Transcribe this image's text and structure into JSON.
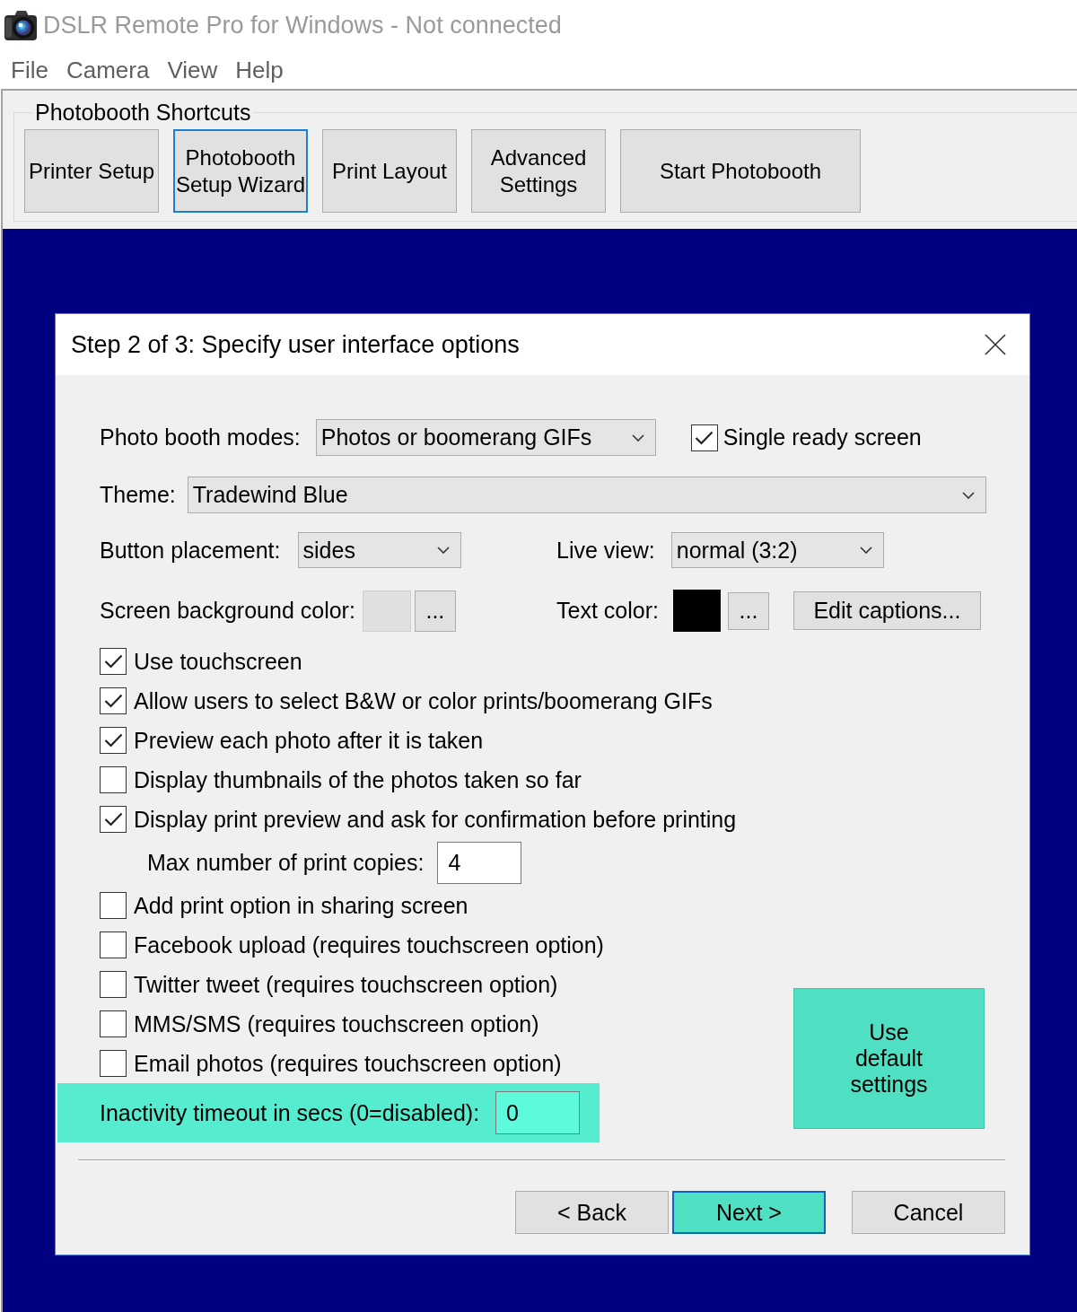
{
  "window": {
    "title": "DSLR Remote Pro for Windows - Not connected"
  },
  "menu": [
    "File",
    "Camera",
    "View",
    "Help"
  ],
  "shortcuts": {
    "title": "Photobooth Shortcuts",
    "buttons": [
      {
        "label": "Printer Setup",
        "focused": false
      },
      {
        "label": "Photobooth Setup Wizard",
        "focused": true
      },
      {
        "label": "Print Layout",
        "focused": false
      },
      {
        "label": "Advanced Settings",
        "focused": false
      },
      {
        "label": "Start Photobooth",
        "focused": false
      }
    ]
  },
  "dialog": {
    "title": "Step 2 of 3: Specify user interface options",
    "modes": {
      "label": "Photo booth modes:",
      "value": "Photos or boomerang GIFs"
    },
    "single_ready_screen": {
      "label": "Single ready screen",
      "checked": true
    },
    "theme": {
      "label": "Theme:",
      "value": "Tradewind Blue"
    },
    "button_placement": {
      "label": "Button placement:",
      "value": "sides"
    },
    "live_view": {
      "label": "Live view:",
      "value": "normal (3:2)"
    },
    "screen_background_color": {
      "label": "Screen background color:",
      "color": "#e0e0e0",
      "button": "..."
    },
    "text_color": {
      "label": "Text color:",
      "color": "#000000",
      "button": "..."
    },
    "edit_captions": {
      "label": "Edit captions..."
    },
    "options": [
      {
        "kind": "checkbox",
        "label": "Use touchscreen",
        "checked": true
      },
      {
        "kind": "checkbox",
        "label": "Allow users to select B&W or color prints/boomerang GIFs",
        "checked": true
      },
      {
        "kind": "checkbox",
        "label": "Preview each photo after it is taken",
        "checked": true
      },
      {
        "kind": "checkbox",
        "label": "Display thumbnails of the photos taken so far",
        "checked": false
      },
      {
        "kind": "checkbox",
        "label": "Display print preview and ask for confirmation before printing",
        "checked": true,
        "children": [
          {
            "kind": "field",
            "label": "Max number of print copies:",
            "value": "4"
          }
        ]
      }
    ],
    "more_options": [
      {
        "kind": "checkbox",
        "label": "Add print option in sharing screen",
        "checked": false
      },
      {
        "kind": "checkbox",
        "label": "Facebook upload (requires touchscreen option)",
        "checked": false
      },
      {
        "kind": "checkbox",
        "label": "Twitter tweet (requires touchscreen option)",
        "checked": false
      },
      {
        "kind": "checkbox",
        "label": "MMS/SMS (requires touchscreen option)",
        "checked": false
      },
      {
        "kind": "checkbox",
        "label": "Email photos (requires touchscreen option)",
        "checked": false
      }
    ],
    "inactivity_timeout": {
      "label": "Inactivity timeout in secs (0=disabled):",
      "value": "0",
      "highlighted": true
    },
    "default_settings_button": {
      "label": "Use default settings",
      "highlighted": true
    },
    "buttons": [
      {
        "label": "< Back",
        "default": false,
        "highlighted": false
      },
      {
        "label": "Next >",
        "default": true,
        "highlighted": true
      },
      {
        "label": "Cancel",
        "default": false,
        "highlighted": false
      }
    ]
  }
}
